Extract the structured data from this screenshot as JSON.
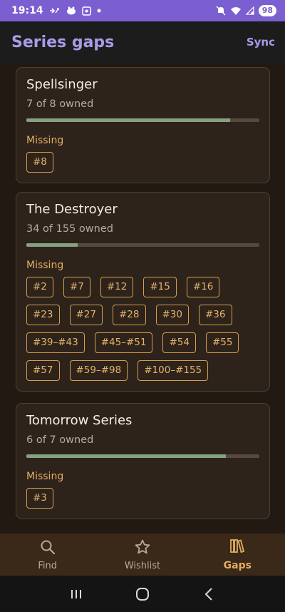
{
  "status_bar": {
    "time": "19:14",
    "battery": "98"
  },
  "app_bar": {
    "title": "Series gaps",
    "sync_label": "Sync"
  },
  "missing_label": "Missing",
  "series": [
    {
      "title": "Spellsinger",
      "owned_text": "7 of 8 owned",
      "progress": 0.875,
      "missing": [
        "#8"
      ]
    },
    {
      "title": "The Destroyer",
      "owned_text": "34 of 155 owned",
      "progress": 0.219,
      "missing": [
        "#2",
        "#7",
        "#12",
        "#15",
        "#16",
        "#23",
        "#27",
        "#28",
        "#30",
        "#36",
        "#39–#43",
        "#45–#51",
        "#54",
        "#55",
        "#57",
        "#59–#98",
        "#100–#155"
      ]
    },
    {
      "title": "Tomorrow Series",
      "owned_text": "6 of 7 owned",
      "progress": 0.857,
      "missing": [
        "#3"
      ]
    }
  ],
  "bottom_nav": {
    "items": [
      {
        "label": "Find",
        "icon": "search-icon",
        "active": false
      },
      {
        "label": "Wishlist",
        "icon": "star-icon",
        "active": false
      },
      {
        "label": "Gaps",
        "icon": "books-icon",
        "active": true
      }
    ]
  },
  "colors": {
    "status_bar": "#7b5fd1",
    "accent": "#a99be8",
    "chip": "#e3b36a",
    "progress": "#83a27d",
    "background": "#221912"
  }
}
